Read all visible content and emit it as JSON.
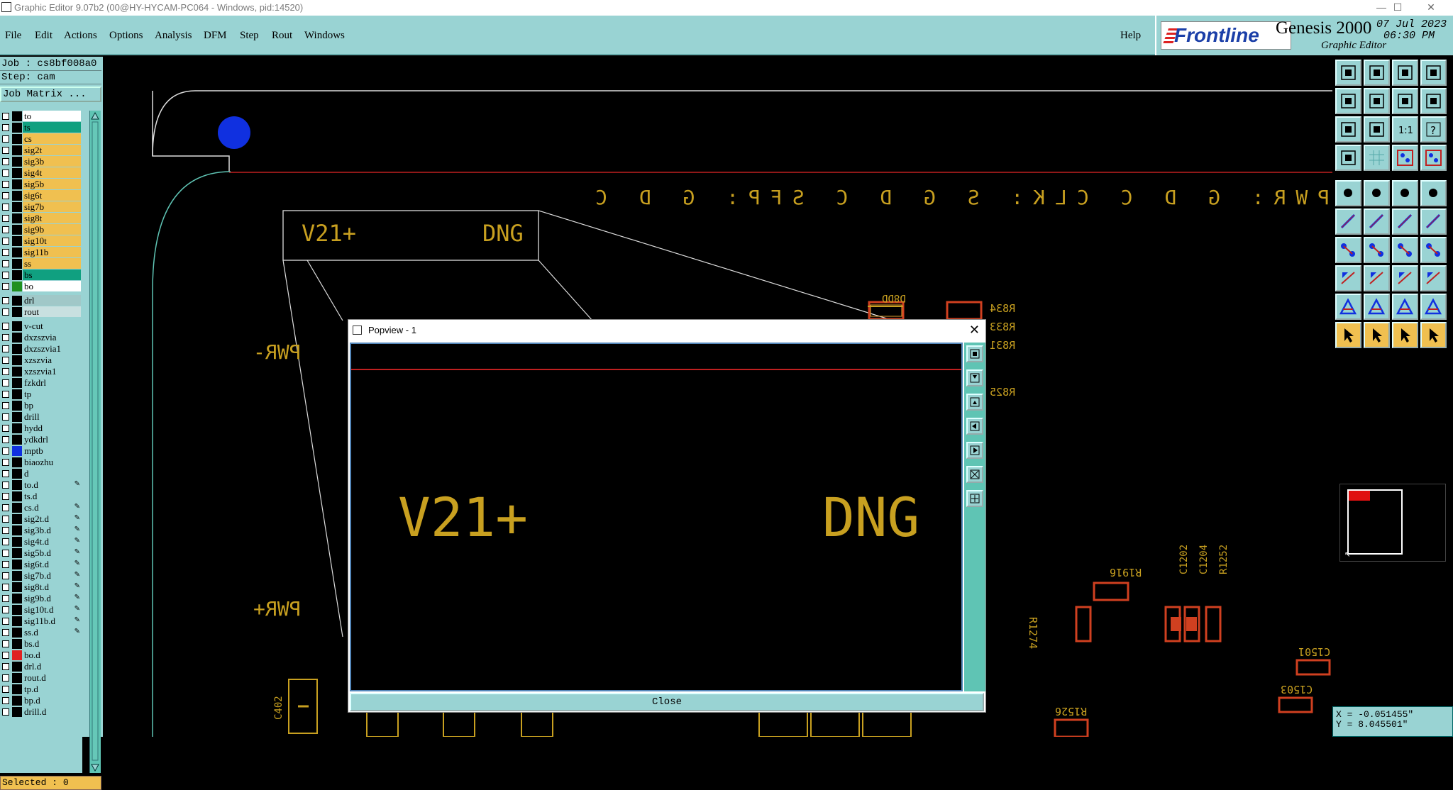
{
  "window": {
    "title": "Graphic Editor 9.07b2 (00@HY-HYCAM-PC064 - Windows, pid:14520)",
    "minimize": "—",
    "maximize": "☐",
    "close": "✕"
  },
  "menu": [
    "File",
    "Edit",
    "Actions",
    "Options",
    "Analysis",
    "DFM",
    "Step",
    "Rout",
    "Windows"
  ],
  "help": "Help",
  "brand": {
    "logo": "Frontline",
    "product": "Genesis 2000",
    "subtitle": "Graphic Editor",
    "date": "07 Jul 2023",
    "time": "06:30 PM"
  },
  "job": {
    "job_line": "Job : cs8bf008a0",
    "step_line": "Step: cam",
    "matrix_button": "Job Matrix ...",
    "selected": "Selected : 0"
  },
  "layers": [
    {
      "name": "to",
      "color": "#ffffff",
      "swatch": "#000000"
    },
    {
      "name": "ts",
      "color": "#10a080",
      "swatch": "#000000"
    },
    {
      "name": "cs",
      "color": "#f0c050",
      "swatch": "#000000"
    },
    {
      "name": "sig2t",
      "color": "#f0c050",
      "swatch": "#000000"
    },
    {
      "name": "sig3b",
      "color": "#f0c050",
      "swatch": "#000000"
    },
    {
      "name": "sig4t",
      "color": "#f0c050",
      "swatch": "#000000"
    },
    {
      "name": "sig5b",
      "color": "#f0c050",
      "swatch": "#000000"
    },
    {
      "name": "sig6t",
      "color": "#f0c050",
      "swatch": "#000000"
    },
    {
      "name": "sig7b",
      "color": "#f0c050",
      "swatch": "#000000"
    },
    {
      "name": "sig8t",
      "color": "#f0c050",
      "swatch": "#000000"
    },
    {
      "name": "sig9b",
      "color": "#f0c050",
      "swatch": "#000000"
    },
    {
      "name": "sig10t",
      "color": "#f0c050",
      "swatch": "#000000"
    },
    {
      "name": "sig11b",
      "color": "#f0c050",
      "swatch": "#000000"
    },
    {
      "name": "ss",
      "color": "#f0c050",
      "swatch": "#000000"
    },
    {
      "name": "bs",
      "color": "#10a080",
      "swatch": "#000000"
    },
    {
      "name": "bo",
      "color": "#ffffff",
      "swatch": "#209020",
      "active": true
    },
    {
      "gap": true
    },
    {
      "name": "drl",
      "color": "#a0c8c8",
      "swatch": "#000000"
    },
    {
      "name": "rout",
      "color": "#c8e0e0",
      "swatch": "#000000"
    },
    {
      "gap": true
    },
    {
      "name": "v-cut",
      "color": "#99d3d3",
      "swatch": "#000000"
    },
    {
      "name": "dxzszvia",
      "color": "#99d3d3",
      "swatch": "#000000"
    },
    {
      "name": "dxzszvia1",
      "color": "#99d3d3",
      "swatch": "#000000"
    },
    {
      "name": "xzszvia",
      "color": "#99d3d3",
      "swatch": "#000000"
    },
    {
      "name": "xzszvia1",
      "color": "#99d3d3",
      "swatch": "#000000"
    },
    {
      "name": "fzkdrl",
      "color": "#99d3d3",
      "swatch": "#000000"
    },
    {
      "name": "tp",
      "color": "#99d3d3",
      "swatch": "#000000"
    },
    {
      "name": "bp",
      "color": "#99d3d3",
      "swatch": "#000000"
    },
    {
      "name": "drill",
      "color": "#99d3d3",
      "swatch": "#000000"
    },
    {
      "name": "hydd",
      "color": "#99d3d3",
      "swatch": "#000000"
    },
    {
      "name": "ydkdrl",
      "color": "#99d3d3",
      "swatch": "#000000"
    },
    {
      "name": "mptb",
      "color": "#99d3d3",
      "swatch": "#1030e0"
    },
    {
      "name": "biaozhu",
      "color": "#99d3d3",
      "swatch": "#000000"
    },
    {
      "name": "d",
      "color": "#99d3d3",
      "swatch": "#000000"
    },
    {
      "name": "to.d",
      "color": "#99d3d3",
      "swatch": "#000000",
      "mark": "✎"
    },
    {
      "name": "ts.d",
      "color": "#99d3d3",
      "swatch": "#000000"
    },
    {
      "name": "cs.d",
      "color": "#99d3d3",
      "swatch": "#000000",
      "mark": "✎"
    },
    {
      "name": "sig2t.d",
      "color": "#99d3d3",
      "swatch": "#000000",
      "mark": "✎"
    },
    {
      "name": "sig3b.d",
      "color": "#99d3d3",
      "swatch": "#000000",
      "mark": "✎"
    },
    {
      "name": "sig4t.d",
      "color": "#99d3d3",
      "swatch": "#000000",
      "mark": "✎"
    },
    {
      "name": "sig5b.d",
      "color": "#99d3d3",
      "swatch": "#000000",
      "mark": "✎"
    },
    {
      "name": "sig6t.d",
      "color": "#99d3d3",
      "swatch": "#000000",
      "mark": "✎"
    },
    {
      "name": "sig7b.d",
      "color": "#99d3d3",
      "swatch": "#000000",
      "mark": "✎"
    },
    {
      "name": "sig8t.d",
      "color": "#99d3d3",
      "swatch": "#000000",
      "mark": "✎"
    },
    {
      "name": "sig9b.d",
      "color": "#99d3d3",
      "swatch": "#000000",
      "mark": "✎"
    },
    {
      "name": "sig10t.d",
      "color": "#99d3d3",
      "swatch": "#000000",
      "mark": "✎"
    },
    {
      "name": "sig11b.d",
      "color": "#99d3d3",
      "swatch": "#000000",
      "mark": "✎"
    },
    {
      "name": "ss.d",
      "color": "#99d3d3",
      "swatch": "#000000",
      "mark": "✎"
    },
    {
      "name": "bs.d",
      "color": "#99d3d3",
      "swatch": "#000000"
    },
    {
      "name": "bo.d",
      "color": "#99d3d3",
      "swatch": "#e02020"
    },
    {
      "name": "drl.d",
      "color": "#99d3d3",
      "swatch": "#000000"
    },
    {
      "name": "rout.d",
      "color": "#99d3d3",
      "swatch": "#000000"
    },
    {
      "name": "tp.d",
      "color": "#99d3d3",
      "swatch": "#000000"
    },
    {
      "name": "bp.d",
      "color": "#99d3d3",
      "swatch": "#000000"
    },
    {
      "name": "drill.d",
      "color": "#99d3d3",
      "swatch": "#000000"
    }
  ],
  "board_text": {
    "header_row": "PWR: G D C   CLK: S G D C   SFP: G D C",
    "box_left": "V21+",
    "box_right": "DNG",
    "pwr_minus": "PWR-",
    "pwr_plus": "PWR+",
    "d8dd": "D8DD",
    "r834": "R834",
    "r833": "R833",
    "r831": "R831",
    "r825": "R825",
    "r1916": "R1916",
    "r1274": "R1274",
    "c1202": "C1202",
    "c1204": "C1204",
    "r1252": "R1252",
    "c1501": "C1501",
    "c1503": "C1503",
    "c402": "C402",
    "r1526": "R1526"
  },
  "popview": {
    "title": "Popview - 1",
    "left_text": "V21+",
    "right_text": "DNG",
    "close_label": "Close"
  },
  "coords": {
    "x": "X = -0.051455\"",
    "y": "Y = 8.045501\""
  },
  "colors": {
    "panel": "#99d3d3",
    "silk": "#c8a020",
    "outline": "#ffffff",
    "board_red": "#c02020"
  }
}
